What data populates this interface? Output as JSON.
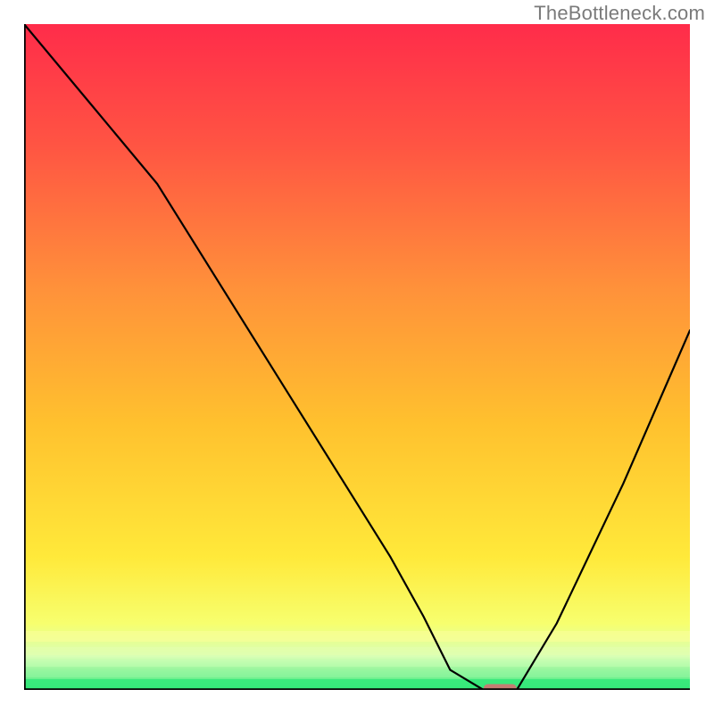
{
  "watermark": "TheBottleneck.com",
  "chart_data": {
    "type": "line",
    "title": "",
    "xlabel": "",
    "ylabel": "",
    "xlim": [
      0,
      100
    ],
    "ylim": [
      0,
      100
    ],
    "x": [
      0,
      10,
      20,
      30,
      40,
      50,
      55,
      60,
      64,
      69,
      74,
      80,
      90,
      100
    ],
    "values": [
      100,
      88,
      76,
      60,
      44,
      28,
      20,
      11,
      3,
      0,
      0,
      10,
      31,
      54
    ],
    "gradient_colors": {
      "top": "#ff2c4a",
      "mid": "#ffd23b",
      "bottom": "#35e87a"
    },
    "marker": {
      "x_start": 69,
      "x_end": 74,
      "y": 0,
      "color": "#dd6a72"
    }
  }
}
